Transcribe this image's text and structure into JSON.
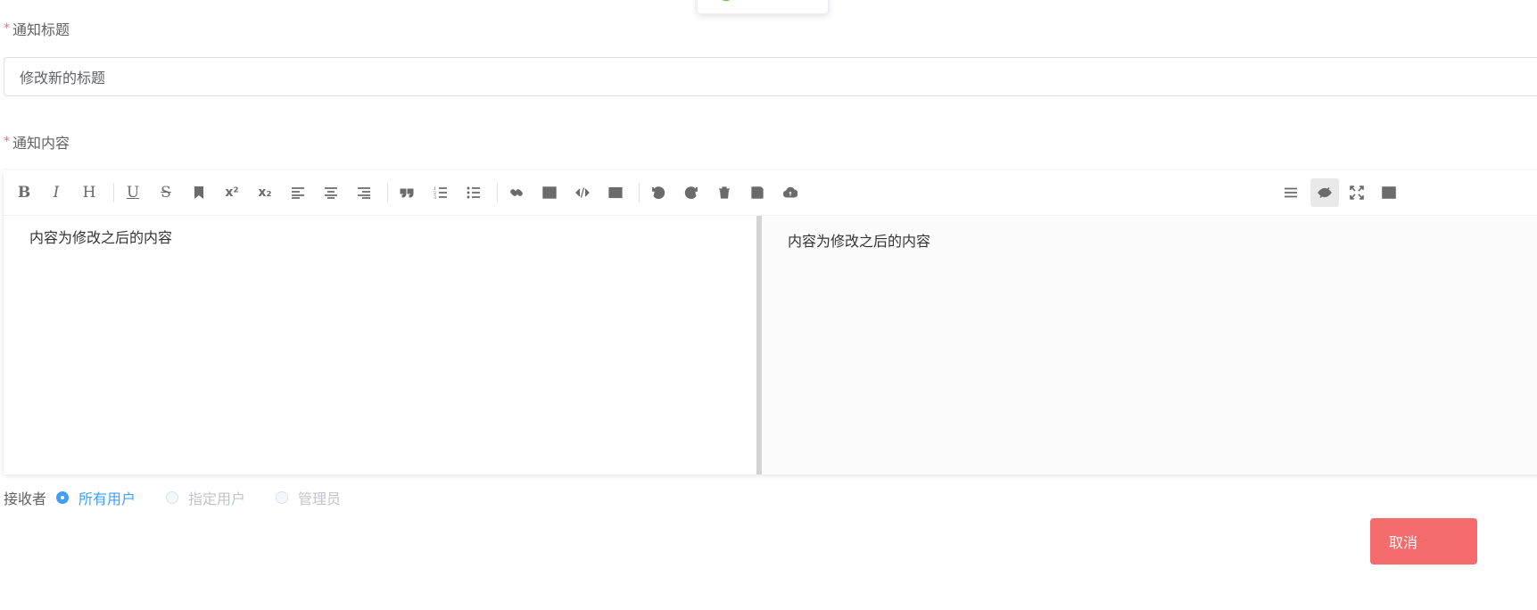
{
  "form": {
    "title_label": "通知标题",
    "title_value": "修改新的标题",
    "content_label": "通知内容",
    "required_mark": "*"
  },
  "editor": {
    "toolbar_left": [
      {
        "name": "bold",
        "glyph": "B"
      },
      {
        "name": "italic",
        "glyph": "I"
      },
      {
        "name": "header",
        "glyph": "H"
      },
      {
        "name": "underline",
        "glyph": "U"
      },
      {
        "name": "strikethrough",
        "glyph": "S"
      },
      {
        "name": "mark",
        "glyph": "bookmark-icon"
      },
      {
        "name": "superscript",
        "glyph": "x²"
      },
      {
        "name": "subscript",
        "glyph": "x₂"
      },
      {
        "name": "align-left",
        "glyph": "align-left-icon"
      },
      {
        "name": "align-center",
        "glyph": "align-center-icon"
      },
      {
        "name": "align-right",
        "glyph": "align-right-icon"
      },
      {
        "name": "quote",
        "glyph": "quote-icon"
      },
      {
        "name": "ordered-list",
        "glyph": "ordered-list-icon"
      },
      {
        "name": "unordered-list",
        "glyph": "unordered-list-icon"
      },
      {
        "name": "link",
        "glyph": "link-icon"
      },
      {
        "name": "image",
        "glyph": "image-icon"
      },
      {
        "name": "code",
        "glyph": "code-icon"
      },
      {
        "name": "table",
        "glyph": "table-icon"
      },
      {
        "name": "undo",
        "glyph": "undo-icon"
      },
      {
        "name": "redo",
        "glyph": "redo-icon"
      },
      {
        "name": "trash",
        "glyph": "trash-icon"
      },
      {
        "name": "save",
        "glyph": "save-icon"
      },
      {
        "name": "upload",
        "glyph": "cloud-upload-icon"
      }
    ],
    "toolbar_right": [
      {
        "name": "navigation",
        "glyph": "menu-icon"
      },
      {
        "name": "preview-toggle",
        "glyph": "eye-slash-icon",
        "active": true
      },
      {
        "name": "fullscreen",
        "glyph": "expand-icon"
      },
      {
        "name": "read-mode",
        "glyph": "window-icon"
      }
    ],
    "source_text": "内容为修改之后的内容",
    "preview_text": "内容为修改之后的内容"
  },
  "recipients": {
    "label": "接收者",
    "options": [
      {
        "label": "所有用户",
        "checked": true
      },
      {
        "label": "指定用户",
        "checked": false
      },
      {
        "label": "管理员",
        "checked": false
      }
    ]
  },
  "actions": {
    "cancel_label": "取消"
  },
  "colors": {
    "primary": "#409eff",
    "danger": "#f56c6c",
    "success": "#67c23a"
  }
}
